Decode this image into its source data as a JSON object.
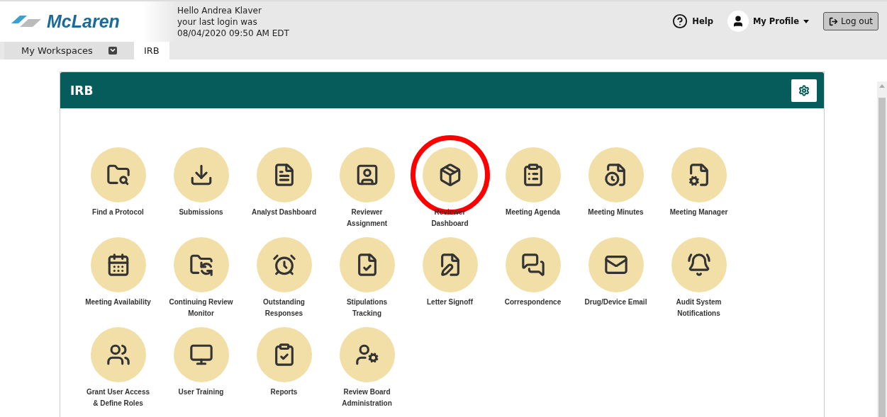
{
  "header": {
    "logo": "McLaren",
    "greeting": [
      "Hello Andrea Klaver",
      "your last login was",
      "08/04/2020 09:50 AM EDT"
    ],
    "help": "Help",
    "profile": "My Profile",
    "logout": "Log out"
  },
  "tabs": [
    {
      "label": "My Workspaces",
      "selected": false,
      "dropdown": true
    },
    {
      "label": "IRB",
      "selected": true,
      "dropdown": false
    }
  ],
  "panel": {
    "title": "IRB",
    "tiles": [
      {
        "label": "Find a Protocol",
        "highlighted": false
      },
      {
        "label": "Submissions",
        "highlighted": false
      },
      {
        "label": "Analyst Dashboard",
        "highlighted": false
      },
      {
        "label": "Reviewer Assignment",
        "highlighted": false
      },
      {
        "label": "Reviewer Dashboard",
        "highlighted": true
      },
      {
        "label": "Meeting Agenda",
        "highlighted": false
      },
      {
        "label": "Meeting Minutes",
        "highlighted": false
      },
      {
        "label": "Meeting Manager",
        "highlighted": false
      },
      {
        "label": "Meeting Availability",
        "highlighted": false
      },
      {
        "label": "Continuing Review Monitor",
        "highlighted": false
      },
      {
        "label": "Outstanding Responses",
        "highlighted": false
      },
      {
        "label": "Stipulations Tracking",
        "highlighted": false
      },
      {
        "label": "Letter Signoff",
        "highlighted": false
      },
      {
        "label": "Correspondence",
        "highlighted": false
      },
      {
        "label": "Drug/Device Email",
        "highlighted": false
      },
      {
        "label": "Audit System Notifications",
        "highlighted": false
      },
      {
        "label": "Grant User Access & Define Roles",
        "highlighted": false
      },
      {
        "label": "User Training",
        "highlighted": false
      },
      {
        "label": "Reports",
        "highlighted": false
      },
      {
        "label": "Review Board Administration",
        "highlighted": false
      }
    ]
  }
}
